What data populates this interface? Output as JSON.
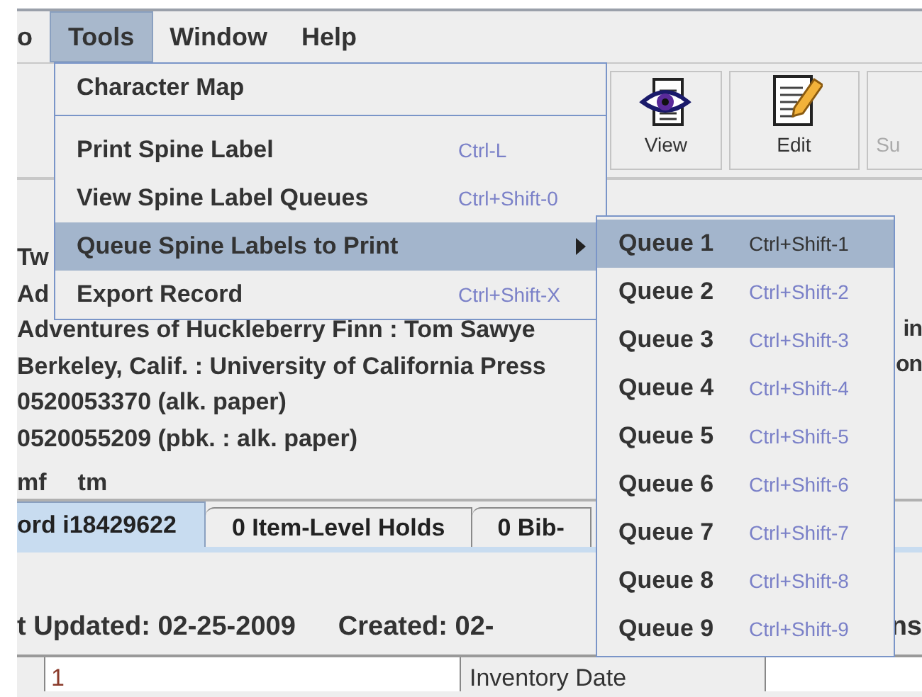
{
  "menu_bar": [
    {
      "label": "o",
      "selected": false
    },
    {
      "label": "Tools",
      "selected": true
    },
    {
      "label": "Window",
      "selected": false
    },
    {
      "label": "Help",
      "selected": false
    }
  ],
  "toolbar": [
    {
      "kind": "view",
      "label": "View"
    },
    {
      "kind": "edit",
      "label": "Edit"
    },
    {
      "kind": "cut",
      "label": "Su"
    }
  ],
  "record_lines": [
    {
      "left": "Tw"
    },
    {
      "left": "Ad"
    },
    {
      "left": "Adventures of Huckleberry Finn : Tom Sawye",
      "right": "in"
    },
    {
      "left": "Berkeley, Calif. : University of California Press",
      "right": "on"
    },
    {
      "left": "0520053370 (alk. paper)"
    },
    {
      "left": "0520055209 (pbk. : alk. paper)"
    }
  ],
  "cut_line": [
    "mf",
    "tm"
  ],
  "tabs": [
    {
      "label": "ord i18429622",
      "selected": true
    },
    {
      "label": "0 Item-Level Holds",
      "selected": false
    },
    {
      "label": "0 Bib-",
      "selected": false
    }
  ],
  "status": {
    "updated": "t Updated: 02-25-2009",
    "created": "Created: 02-",
    "right": "ns"
  },
  "table_row": [
    "1",
    "Inventory Date"
  ],
  "tools_menu": [
    {
      "label": "Character Map",
      "selected": false,
      "separator_after": true
    },
    {
      "label": "Print Spine Label",
      "shortcut": "Ctrl-L",
      "selected": false
    },
    {
      "label": "View Spine Label Queues",
      "shortcut": "Ctrl+Shift-0",
      "selected": false
    },
    {
      "label": "Queue Spine Labels to Print",
      "submenu": true,
      "selected": true
    },
    {
      "label": "Export Record",
      "shortcut": "Ctrl+Shift-X",
      "selected": false
    }
  ],
  "queue_submenu": [
    {
      "label": "Queue 1",
      "shortcut": "Ctrl+Shift-1",
      "selected": true
    },
    {
      "label": "Queue 2",
      "shortcut": "Ctrl+Shift-2",
      "selected": false
    },
    {
      "label": "Queue 3",
      "shortcut": "Ctrl+Shift-3",
      "selected": false
    },
    {
      "label": "Queue 4",
      "shortcut": "Ctrl+Shift-4",
      "selected": false
    },
    {
      "label": "Queue 5",
      "shortcut": "Ctrl+Shift-5",
      "selected": false
    },
    {
      "label": "Queue 6",
      "shortcut": "Ctrl+Shift-6",
      "selected": false
    },
    {
      "label": "Queue 7",
      "shortcut": "Ctrl+Shift-7",
      "selected": false
    },
    {
      "label": "Queue 8",
      "shortcut": "Ctrl+Shift-8",
      "selected": false
    },
    {
      "label": "Queue 9",
      "shortcut": "Ctrl+Shift-9",
      "selected": false
    }
  ]
}
